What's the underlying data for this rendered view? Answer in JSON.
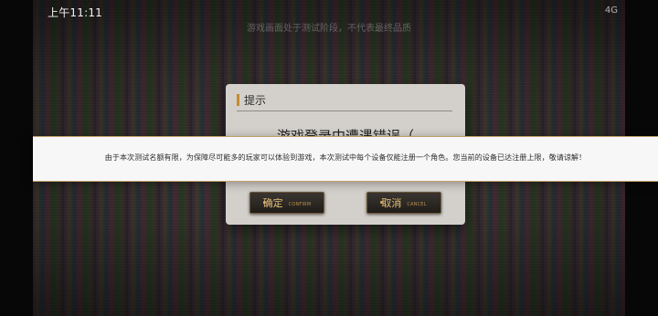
{
  "status_bar": {
    "time": "上午11:11",
    "indicators": "4G"
  },
  "watermark": "游戏画面处于测试阶段，不代表最终品质",
  "dialog": {
    "title": "提示",
    "message_partial": "游戏登录中遭遇错误（",
    "buttons": {
      "confirm_label": "确定",
      "confirm_sub": "CONFIRM",
      "cancel_label": "取消",
      "cancel_sub": "CANCEL"
    }
  },
  "banner": {
    "text": "由于本次测试名额有限，为保障尽可能多的玩家可以体验到游戏，本次测试中每个设备仅能注册一个角色。您当前的设备已达注册上限，敬请谅解！"
  },
  "colors": {
    "accent_gold": "#c58b2b",
    "dialog_bg": "#d3d0cb",
    "button_text": "#e6c07a"
  }
}
